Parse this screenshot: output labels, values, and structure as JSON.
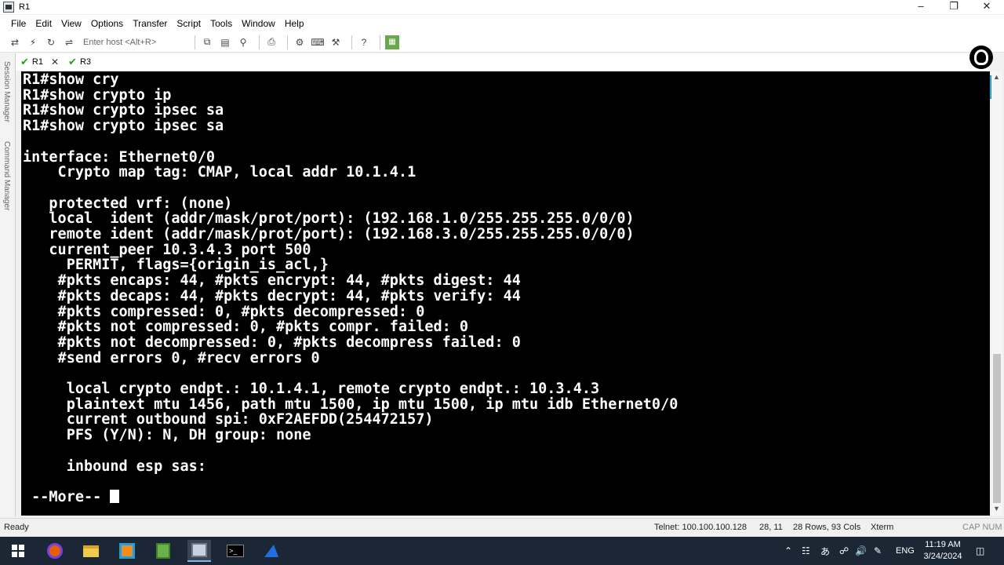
{
  "window": {
    "title": "R1"
  },
  "menu": [
    "File",
    "Edit",
    "View",
    "Options",
    "Transfer",
    "Script",
    "Tools",
    "Window",
    "Help"
  ],
  "toolbar": {
    "host_placeholder": "Enter host <Alt+R>"
  },
  "tabs": [
    {
      "label": "R1",
      "active": true
    },
    {
      "label": "R3",
      "active": false
    }
  ],
  "side_panel": {
    "session_manager": "Session Manager",
    "command_manager": "Command Manager"
  },
  "terminal": {
    "lines": [
      "R1#show cry",
      "R1#show crypto ip",
      "R1#show crypto ipsec sa",
      "R1#show crypto ipsec sa",
      "",
      "interface: Ethernet0/0",
      "    Crypto map tag: CMAP, local addr 10.1.4.1",
      "",
      "   protected vrf: (none)",
      "   local  ident (addr/mask/prot/port): (192.168.1.0/255.255.255.0/0/0)",
      "   remote ident (addr/mask/prot/port): (192.168.3.0/255.255.255.0/0/0)",
      "   current_peer 10.3.4.3 port 500",
      "     PERMIT, flags={origin_is_acl,}",
      "    #pkts encaps: 44, #pkts encrypt: 44, #pkts digest: 44",
      "    #pkts decaps: 44, #pkts decrypt: 44, #pkts verify: 44",
      "    #pkts compressed: 0, #pkts decompressed: 0",
      "    #pkts not compressed: 0, #pkts compr. failed: 0",
      "    #pkts not decompressed: 0, #pkts decompress failed: 0",
      "    #send errors 0, #recv errors 0",
      "",
      "     local crypto endpt.: 10.1.4.1, remote crypto endpt.: 10.3.4.3",
      "     plaintext mtu 1456, path mtu 1500, ip mtu 1500, ip mtu idb Ethernet0/0",
      "     current outbound spi: 0xF2AEFDD(254472157)",
      "     PFS (Y/N): N, DH group: none",
      "",
      "     inbound esp sas:",
      "",
      " --More-- "
    ]
  },
  "status": {
    "left": "Ready",
    "connection": "Telnet: 100.100.100.128",
    "cursor_pos": "28, 11",
    "size": "28 Rows, 93 Cols",
    "emulation": "Xterm",
    "keys": "CAP  NUM"
  },
  "taskbar": {
    "language": "ENG",
    "time": "11:19 AM",
    "date": "3/24/2024"
  },
  "colors": {
    "terminal_bg": "#000000",
    "terminal_fg": "#ffffff",
    "taskbar_bg": "#1c2736",
    "tab_check": "#1ea21e"
  }
}
